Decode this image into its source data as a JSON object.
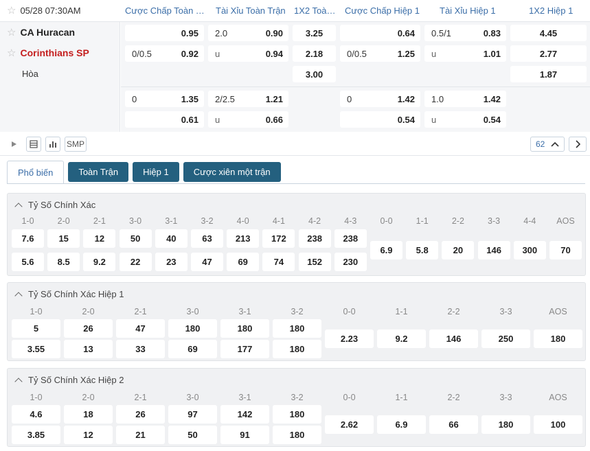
{
  "header": {
    "datetime": "05/28 07:30AM",
    "columns": [
      "Cược Chấp Toàn T...",
      "Tài Xỉu Toàn Trận",
      "1X2 Toàn...",
      "Cược Chấp Hiệp 1",
      "Tài Xỉu Hiệp 1",
      "1X2 Hiệp 1"
    ]
  },
  "teams": {
    "home": "CA Huracan",
    "away": "Corinthians SP",
    "draw": "Hòa"
  },
  "main_odds": {
    "r1": {
      "hc_home": "0.95",
      "ou_line": "2.0",
      "ou_over": "0.90",
      "x_home": "3.25",
      "h1_hc_home": "0.64",
      "h1_ou_line": "0.5/1",
      "h1_ou_over": "0.83",
      "h1_x_home": "4.45"
    },
    "r2": {
      "hc_line": "0/0.5",
      "hc_away": "0.92",
      "ou_u": "u",
      "ou_under": "0.94",
      "x_away": "2.18",
      "h1_hc_line": "0/0.5",
      "h1_hc_away": "1.25",
      "h1_ou_u": "u",
      "h1_ou_under": "1.01",
      "h1_x_away": "2.77"
    },
    "r3": {
      "x_draw": "3.00",
      "h1_x_draw": "1.87"
    },
    "r4": {
      "hc_line": "0",
      "hc_home": "1.35",
      "ou_line": "2/2.5",
      "ou_over": "1.21",
      "h1_hc_line": "0",
      "h1_hc_home": "1.42",
      "h1_ou_line": "1.0",
      "h1_ou_over": "1.42"
    },
    "r5": {
      "hc_away": "0.61",
      "ou_u": "u",
      "ou_under": "0.66",
      "h1_hc_away": "0.54",
      "h1_ou_u": "u",
      "h1_ou_under": "0.54"
    }
  },
  "toolbar": {
    "smp": "SMP",
    "count": "62"
  },
  "tabs": [
    "Phổ biến",
    "Toàn Trận",
    "Hiệp 1",
    "Cược xiên một trận"
  ],
  "sections": [
    {
      "title": "Tỷ Số Chính Xác",
      "labels": [
        "1-0",
        "2-0",
        "2-1",
        "3-0",
        "3-1",
        "3-2",
        "4-0",
        "4-1",
        "4-2",
        "4-3",
        "0-0",
        "1-1",
        "2-2",
        "3-3",
        "4-4",
        "AOS"
      ],
      "home": [
        "7.6",
        "15",
        "12",
        "50",
        "40",
        "63",
        "213",
        "172",
        "238",
        "238"
      ],
      "away": [
        "5.6",
        "8.5",
        "9.2",
        "22",
        "23",
        "47",
        "69",
        "74",
        "152",
        "230"
      ],
      "draws": [
        "6.9",
        "5.8",
        "20",
        "146",
        "300",
        "70"
      ]
    },
    {
      "title": "Tỷ Số Chính Xác Hiệp 1",
      "labels": [
        "1-0",
        "2-0",
        "2-1",
        "3-0",
        "3-1",
        "3-2",
        "0-0",
        "1-1",
        "2-2",
        "3-3",
        "AOS"
      ],
      "home": [
        "5",
        "26",
        "47",
        "180",
        "180",
        "180"
      ],
      "away": [
        "3.55",
        "13",
        "33",
        "69",
        "177",
        "180"
      ],
      "draws": [
        "2.23",
        "9.2",
        "146",
        "250",
        "180"
      ]
    },
    {
      "title": "Tỷ Số Chính Xác Hiệp 2",
      "labels": [
        "1-0",
        "2-0",
        "2-1",
        "3-0",
        "3-1",
        "3-2",
        "0-0",
        "1-1",
        "2-2",
        "3-3",
        "AOS"
      ],
      "home": [
        "4.6",
        "18",
        "26",
        "97",
        "142",
        "180"
      ],
      "away": [
        "3.85",
        "12",
        "21",
        "50",
        "91",
        "180"
      ],
      "draws": [
        "2.62",
        "6.9",
        "66",
        "180",
        "100"
      ]
    }
  ]
}
